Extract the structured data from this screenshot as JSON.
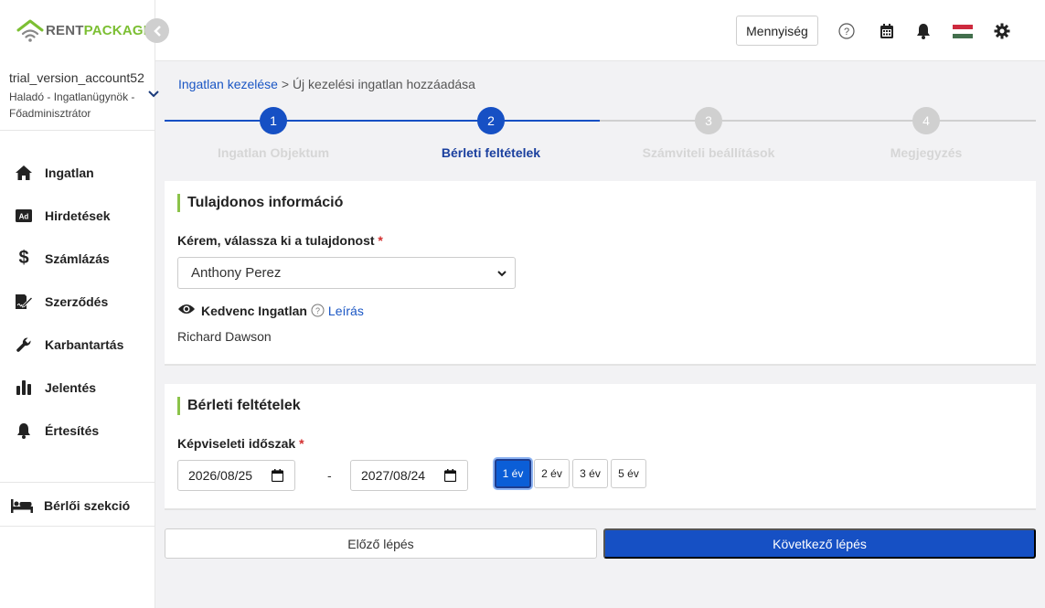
{
  "brand": {
    "part1": "RENT",
    "part2": "PACKAGE"
  },
  "account": {
    "name": "trial_version_account52",
    "role_line1": "Haladó - Ingatlanügynök -",
    "role_line2": "Főadminisztrátor"
  },
  "nav": {
    "items": [
      {
        "label": "Ingatlan",
        "icon": "home-icon"
      },
      {
        "label": "Hirdetések",
        "icon": "ad-icon"
      },
      {
        "label": "Számlázás",
        "icon": "dollar-icon"
      },
      {
        "label": "Szerződés",
        "icon": "contract-icon"
      },
      {
        "label": "Karbantartás",
        "icon": "wrench-icon"
      },
      {
        "label": "Jelentés",
        "icon": "bar-chart-icon"
      },
      {
        "label": "Értesítés",
        "icon": "bell-icon"
      }
    ],
    "bottom": {
      "label": "Bérlői szekció",
      "icon": "bed-icon"
    }
  },
  "header": {
    "quantity_label": "Mennyiség",
    "icons": [
      "help-icon",
      "calendar-icon",
      "bell-icon",
      "hungarian-flag-icon",
      "gear-icon"
    ]
  },
  "breadcrumb": {
    "link": "Ingatlan kezelése",
    "separator": ">",
    "current": "Új kezelési ingatlan hozzáadása"
  },
  "steps": [
    {
      "number": "1",
      "label": "Ingatlan Objektum",
      "state": "done"
    },
    {
      "number": "2",
      "label": "Bérleti feltételek",
      "state": "active"
    },
    {
      "number": "3",
      "label": "Számviteli beállítások",
      "state": "todo"
    },
    {
      "number": "4",
      "label": "Megjegyzés",
      "state": "todo"
    }
  ],
  "owner_card": {
    "title": "Tulajdonos információ",
    "select_label": "Kérem, válassza ki a tulajdonost",
    "required_mark": "*",
    "selected_owner": "Anthony Perez",
    "favorite_label": "Kedvenc Ingatlan",
    "description_link": "Leírás",
    "favorite_name": "Richard Dawson"
  },
  "rental_card": {
    "title": "Bérleti feltételek",
    "period_label": "Képviseleti időszak",
    "required_mark": "*",
    "start_date": "2026/08/25",
    "end_date": "2027/08/24",
    "dash": "-",
    "year_options": [
      "1 év",
      "2 év",
      "3 év",
      "5 év"
    ],
    "selected_year_index": 0
  },
  "footer": {
    "prev_label": "Előző lépés",
    "next_label": "Következő lépés"
  },
  "colors": {
    "primary": "#1650c4",
    "accent_green": "#8bc34a",
    "step_inactive": "#d0d0d0"
  }
}
